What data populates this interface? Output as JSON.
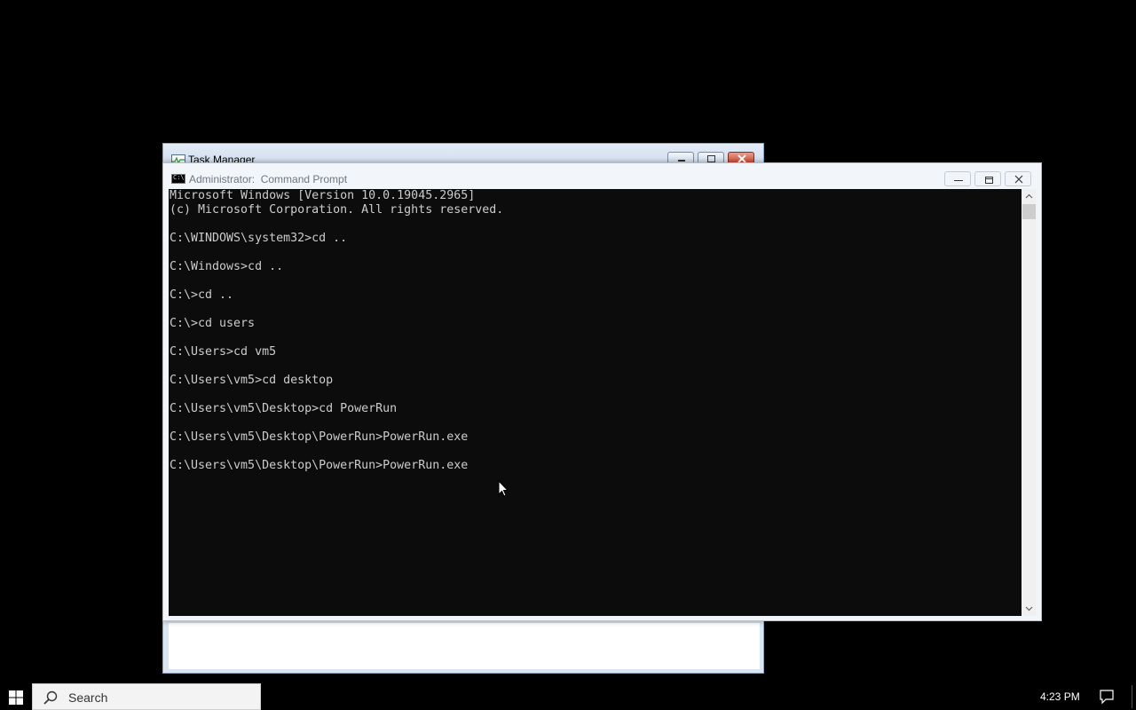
{
  "task_manager": {
    "title": "Task Manager"
  },
  "cmd": {
    "title": "Administrator:  Command Prompt",
    "lines": [
      "Microsoft Windows [Version 10.0.19045.2965]",
      "(c) Microsoft Corporation. All rights reserved.",
      "",
      "C:\\WINDOWS\\system32>cd ..",
      "",
      "C:\\Windows>cd ..",
      "",
      "C:\\>cd ..",
      "",
      "C:\\>cd users",
      "",
      "C:\\Users>cd vm5",
      "",
      "C:\\Users\\vm5>cd desktop",
      "",
      "C:\\Users\\vm5\\Desktop>cd PowerRun",
      "",
      "C:\\Users\\vm5\\Desktop\\PowerRun>PowerRun.exe",
      "",
      "C:\\Users\\vm5\\Desktop\\PowerRun>PowerRun.exe"
    ],
    "icon_label": "C:\\"
  },
  "taskbar": {
    "search_placeholder": "Search",
    "clock": "4:23 PM"
  },
  "colors": {
    "desktop": "#000000",
    "console_bg": "#0c0c0c",
    "console_text": "#cccccc",
    "window_frame": "#f2f5fa"
  }
}
